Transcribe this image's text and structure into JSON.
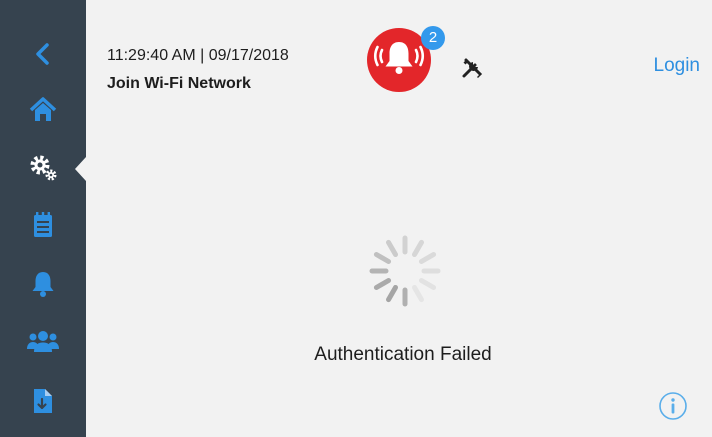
{
  "header": {
    "datetime": "11:29:40 AM | 09/17/2018",
    "title": "Join Wi-Fi Network",
    "login_label": "Login",
    "alarm_count": "2"
  },
  "sidebar": {
    "items": [
      {
        "icon": "back-chevron-icon"
      },
      {
        "icon": "home-icon"
      },
      {
        "icon": "settings-gears-icon",
        "active": true
      },
      {
        "icon": "notepad-icon"
      },
      {
        "icon": "bell-icon"
      },
      {
        "icon": "users-icon"
      },
      {
        "icon": "file-download-icon"
      }
    ]
  },
  "main": {
    "status_text": "Authentication Failed"
  },
  "colors": {
    "sidebar_bg": "#36434f",
    "accent_blue": "#2e8fe0",
    "alarm_red": "#e3262a",
    "badge_blue": "#3399ec",
    "background": "#f2f2f2"
  }
}
